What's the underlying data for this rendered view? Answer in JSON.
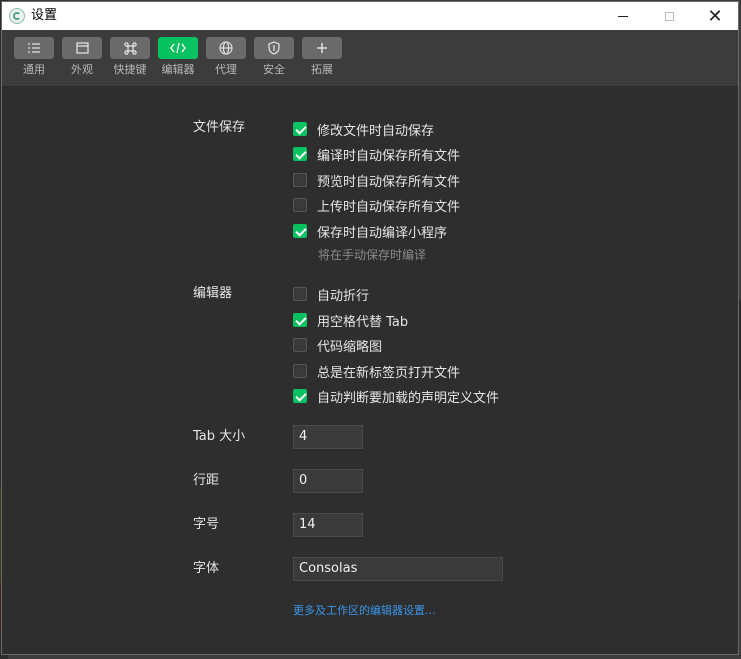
{
  "window": {
    "title": "设置"
  },
  "toolbar": {
    "items": [
      {
        "label": "通用",
        "icon": "general-list-icon",
        "active": false
      },
      {
        "label": "外观",
        "icon": "appearance-window-icon",
        "active": false
      },
      {
        "label": "快捷键",
        "icon": "command-key-icon",
        "active": false
      },
      {
        "label": "编辑器",
        "icon": "code-brackets-icon",
        "active": true
      },
      {
        "label": "代理",
        "icon": "globe-icon",
        "active": false
      },
      {
        "label": "安全",
        "icon": "shield-icon",
        "active": false
      },
      {
        "label": "拓展",
        "icon": "plus-icon",
        "active": false
      }
    ]
  },
  "settings": {
    "file_save": {
      "label": "文件保存",
      "options": [
        {
          "label": "修改文件时自动保存",
          "checked": true
        },
        {
          "label": "编译时自动保存所有文件",
          "checked": true
        },
        {
          "label": "预览时自动保存所有文件",
          "checked": false
        },
        {
          "label": "上传时自动保存所有文件",
          "checked": false
        },
        {
          "label": "保存时自动编译小程序",
          "checked": true
        }
      ],
      "hint": "将在手动保存时编译"
    },
    "editor": {
      "label": "编辑器",
      "options": [
        {
          "label": "自动折行",
          "checked": false
        },
        {
          "label": "用空格代替 Tab",
          "checked": true
        },
        {
          "label": "代码缩略图",
          "checked": false
        },
        {
          "label": "总是在新标签页打开文件",
          "checked": false
        },
        {
          "label": "自动判断要加载的声明定义文件",
          "checked": true
        }
      ]
    },
    "tab_size": {
      "label": "Tab 大小",
      "value": "4"
    },
    "line_spacing": {
      "label": "行距",
      "value": "0"
    },
    "font_size": {
      "label": "字号",
      "value": "14"
    },
    "font_family": {
      "label": "字体",
      "value": "Consolas"
    },
    "more_link": "更多及工作区的编辑器设置..."
  },
  "colors": {
    "accent": "#08c160",
    "link": "#3b95e8",
    "background": "#2e2e2e"
  }
}
